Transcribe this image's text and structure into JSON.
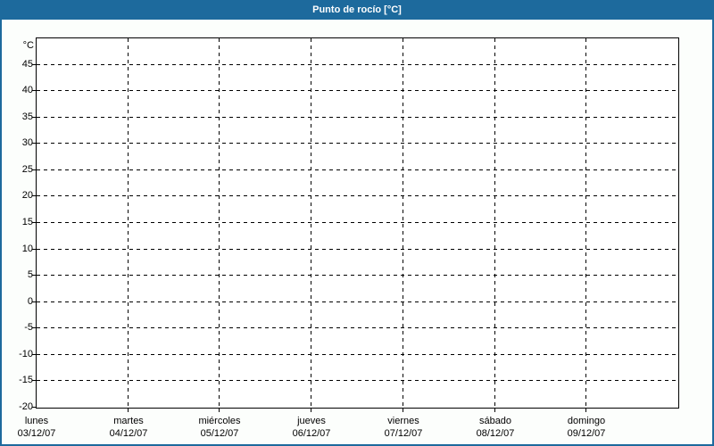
{
  "window": {
    "title": "Punto de rocío [°C]"
  },
  "colors": {
    "titlebar_bg": "#1d6a9d",
    "titlebar_text": "#ffffff",
    "window_border": "#1d6a9d",
    "body_bg": "#fcfefc",
    "plot_bg": "#ffffff",
    "grid_color": "#000000",
    "axis_color": "#000000",
    "label_color": "#000000"
  },
  "chart_data": {
    "type": "line",
    "title": "Punto de rocío [°C]",
    "subtitle": "",
    "y_axis": {
      "unit_label": "°C",
      "min": -20,
      "max": 50,
      "tick_step": 5,
      "tick_labels": [
        45,
        40,
        35,
        30,
        25,
        20,
        15,
        10,
        5,
        0,
        -5,
        -10,
        -15,
        -20
      ]
    },
    "x_axis": {
      "categories": [
        {
          "day": "lunes",
          "date": "03/12/07"
        },
        {
          "day": "martes",
          "date": "04/12/07"
        },
        {
          "day": "miércoles",
          "date": "05/12/07"
        },
        {
          "day": "jueves",
          "date": "06/12/07"
        },
        {
          "day": "viernes",
          "date": "07/12/07"
        },
        {
          "day": "sábado",
          "date": "08/12/07"
        },
        {
          "day": "domingo",
          "date": "09/12/07"
        }
      ]
    },
    "series": [],
    "grid": "dashed",
    "legend": "none"
  }
}
